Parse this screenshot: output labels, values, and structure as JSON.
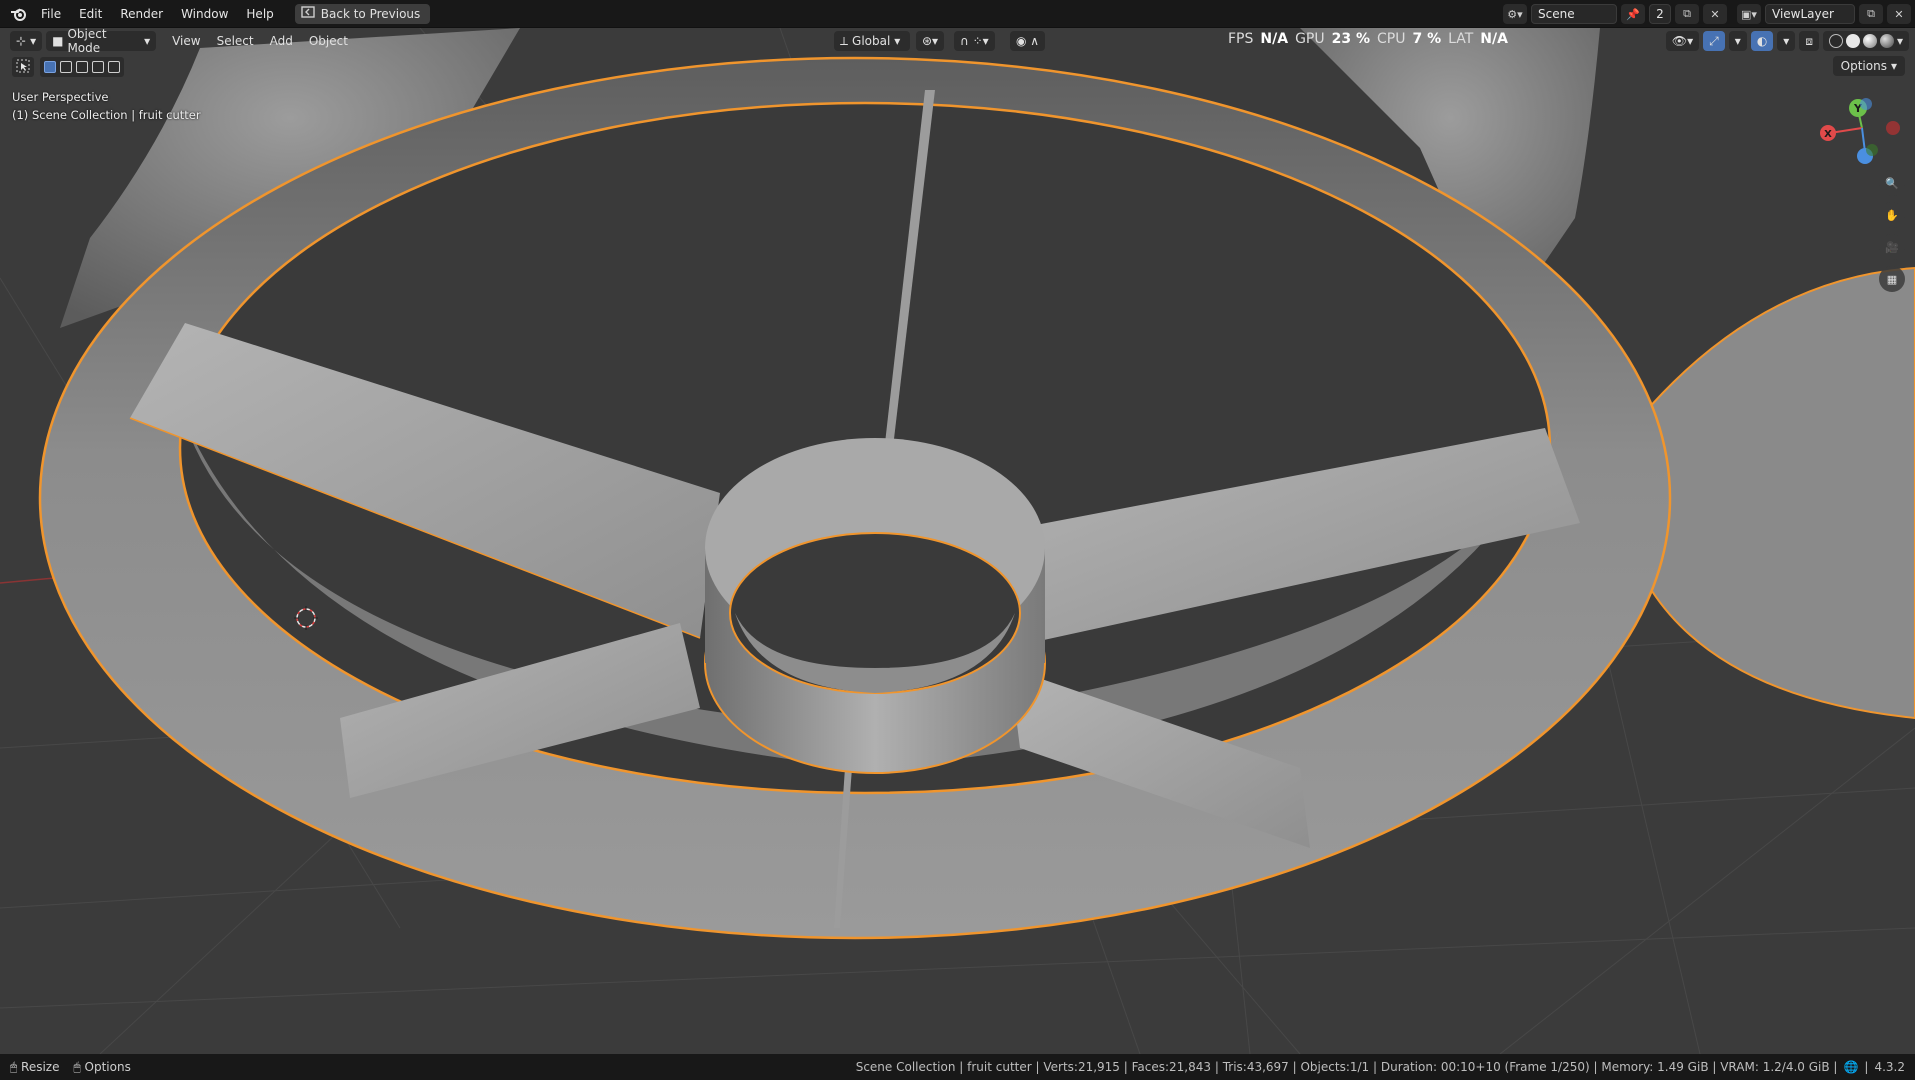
{
  "menu": {
    "items": [
      "File",
      "Edit",
      "Render",
      "Window",
      "Help"
    ],
    "back_button": "Back to Previous"
  },
  "top_right": {
    "scene_label": "Scene",
    "scene_users": "2",
    "view_layer": "ViewLayer"
  },
  "viewport_header": {
    "mode": "Object Mode",
    "menus": [
      "View",
      "Select",
      "Add",
      "Object"
    ],
    "transform_orientation": "Global",
    "options": "Options"
  },
  "stats": {
    "fps_label": "FPS",
    "fps_value": "N/A",
    "gpu_label": "GPU",
    "gpu_value": "23 %",
    "cpu_label": "CPU",
    "cpu_value": "7 %",
    "lat_label": "LAT",
    "lat_value": "N/A"
  },
  "overlay": {
    "view_name": "User Perspective",
    "collection": "(1) Scene Collection | fruit cutter"
  },
  "gizmo": {
    "x": "X",
    "y": "Y"
  },
  "status": {
    "left": [
      "Resize",
      "Options"
    ],
    "info": "Scene Collection | fruit cutter | Verts:21,915 | Faces:21,843 | Tris:43,697 | Objects:1/1 | Duration: 00:10+10 (Frame 1/250) | Memory: 1.49 GiB | VRAM: 1.2/4.0 GiB |",
    "version": "4.3.2"
  },
  "colors": {
    "selection_outline": "#f0952d",
    "axis_x": "#e04a4a",
    "axis_y": "#6cc04a",
    "axis_z": "#4a8fe0",
    "accent": "#4772b3"
  }
}
